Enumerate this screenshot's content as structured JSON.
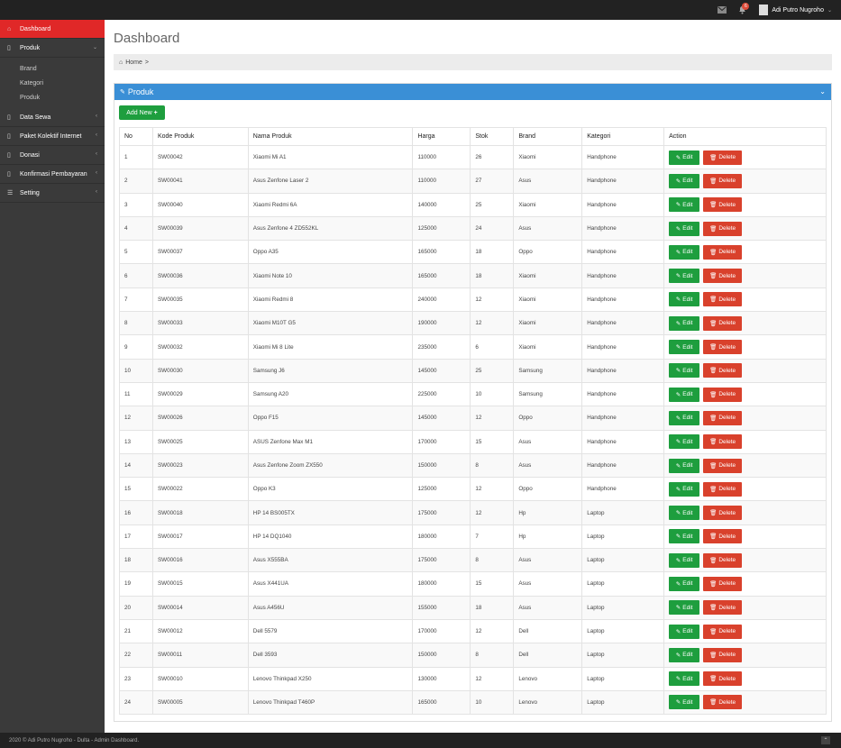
{
  "topbar": {
    "notification_count": "6",
    "user_name": "Adi Putro Nugroho"
  },
  "sidebar": {
    "items": [
      {
        "label": "Dashboard",
        "icon": "home-icon"
      },
      {
        "label": "Produk",
        "icon": "bookmark-icon"
      },
      {
        "label": "Data Sewa",
        "icon": "bookmark-icon"
      },
      {
        "label": "Paket Kolektif Internet",
        "icon": "bookmark-icon"
      },
      {
        "label": "Donasi",
        "icon": "bookmark-icon"
      },
      {
        "label": "Konfirmasi Pembayaran",
        "icon": "bookmark-icon"
      },
      {
        "label": "Setting",
        "icon": "sitemap-icon"
      }
    ],
    "produk_sub": [
      "Brand",
      "Kategori",
      "Produk"
    ]
  },
  "main": {
    "title": "Dashboard",
    "breadcrumb": {
      "home": "Home",
      "separator": ">"
    },
    "panel": {
      "title": "Produk",
      "add_label": "Add New",
      "columns": [
        "No",
        "Kode Produk",
        "Nama Produk",
        "Harga",
        "Stok",
        "Brand",
        "Kategori",
        "Action"
      ],
      "edit_label": "Edit",
      "delete_label": "Delete",
      "rows": [
        [
          "1",
          "SW00042",
          "Xiaomi Mi A1",
          "110000",
          "26",
          "Xiaomi",
          "Handphone"
        ],
        [
          "2",
          "SW00041",
          "Asus Zenfone Laser 2",
          "110000",
          "27",
          "Asus",
          "Handphone"
        ],
        [
          "3",
          "SW00040",
          "Xiaomi Redmi 6A",
          "140000",
          "25",
          "Xiaomi",
          "Handphone"
        ],
        [
          "4",
          "SW00039",
          "Asus Zenfone 4 ZD552KL",
          "125000",
          "24",
          "Asus",
          "Handphone"
        ],
        [
          "5",
          "SW00037",
          "Oppo A35",
          "165000",
          "18",
          "Oppo",
          "Handphone"
        ],
        [
          "6",
          "SW00036",
          "Xiaomi Note 10",
          "165000",
          "18",
          "Xiaomi",
          "Handphone"
        ],
        [
          "7",
          "SW00035",
          "Xiaomi Redmi 8",
          "240000",
          "12",
          "Xiaomi",
          "Handphone"
        ],
        [
          "8",
          "SW00033",
          "Xiaomi M10T G5",
          "190000",
          "12",
          "Xiaomi",
          "Handphone"
        ],
        [
          "9",
          "SW00032",
          "Xiaomi Mi 8 Lite",
          "235000",
          "6",
          "Xiaomi",
          "Handphone"
        ],
        [
          "10",
          "SW00030",
          "Samsung J6",
          "145000",
          "25",
          "Samsung",
          "Handphone"
        ],
        [
          "11",
          "SW00029",
          "Samsung A20",
          "225000",
          "10",
          "Samsung",
          "Handphone"
        ],
        [
          "12",
          "SW00026",
          "Oppo F15",
          "145000",
          "12",
          "Oppo",
          "Handphone"
        ],
        [
          "13",
          "SW00025",
          "ASUS Zenfone Max M1",
          "170000",
          "15",
          "Asus",
          "Handphone"
        ],
        [
          "14",
          "SW00023",
          "Asus Zenfone Zoom ZX550",
          "150000",
          "8",
          "Asus",
          "Handphone"
        ],
        [
          "15",
          "SW00022",
          "Oppo K3",
          "125000",
          "12",
          "Oppo",
          "Handphone"
        ],
        [
          "16",
          "SW00018",
          "HP 14 BS005TX",
          "175000",
          "12",
          "Hp",
          "Laptop"
        ],
        [
          "17",
          "SW00017",
          "HP 14 DQ1040",
          "180000",
          "7",
          "Hp",
          "Laptop"
        ],
        [
          "18",
          "SW00016",
          "Asus X555BA",
          "175000",
          "8",
          "Asus",
          "Laptop"
        ],
        [
          "19",
          "SW00015",
          "Asus X441UA",
          "180000",
          "15",
          "Asus",
          "Laptop"
        ],
        [
          "20",
          "SW00014",
          "Asus A456U",
          "155000",
          "18",
          "Asus",
          "Laptop"
        ],
        [
          "21",
          "SW00012",
          "Dell 5579",
          "170000",
          "12",
          "Dell",
          "Laptop"
        ],
        [
          "22",
          "SW00011",
          "Dell 3593",
          "150000",
          "8",
          "Dell",
          "Laptop"
        ],
        [
          "23",
          "SW00010",
          "Lenovo Thinkpad X250",
          "130000",
          "12",
          "Lenovo",
          "Laptop"
        ],
        [
          "24",
          "SW00005",
          "Lenovo Thinkpad T460P",
          "165000",
          "10",
          "Lenovo",
          "Laptop"
        ]
      ]
    }
  },
  "footer": {
    "text": "2020 © Adi Putro Nugroho - Dulta - Admin Dashboard."
  },
  "colors": {
    "accent_red": "#e02828",
    "panel_blue": "#3a8fd6",
    "btn_green": "#1e9e3e",
    "btn_red": "#d9412c"
  }
}
